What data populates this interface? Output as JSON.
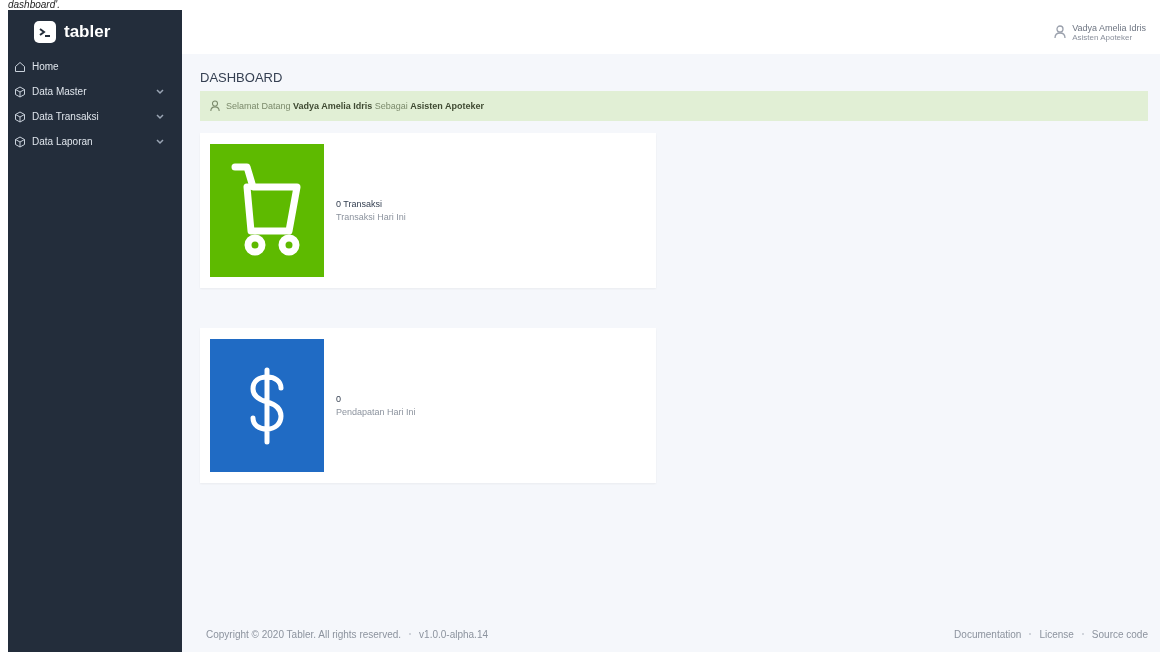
{
  "caption": "dashboard'.",
  "brand": {
    "name": "tabler"
  },
  "sidebar": {
    "items": [
      {
        "label": "Home",
        "kind": "home",
        "expandable": false
      },
      {
        "label": "Data Master",
        "kind": "box",
        "expandable": true
      },
      {
        "label": "Data Transaksi",
        "kind": "box",
        "expandable": true
      },
      {
        "label": "Data Laporan",
        "kind": "box",
        "expandable": true
      }
    ]
  },
  "user": {
    "name": "Vadya Amelia Idris",
    "role": "Asisten Apoteker"
  },
  "page_title": "DASHBOARD",
  "alert": {
    "text": "Selamat Datang **Vadya Amelia Idris** Sebagai **Asisten Apoteker**"
  },
  "cards": [
    {
      "kind": "cart",
      "color": "#5eba00",
      "value": "0 Transaksi",
      "label": "Transaksi Hari Ini"
    },
    {
      "kind": "dollar",
      "color": "#206bc4",
      "value": "0",
      "label": "Pendapatan Hari Ini"
    }
  ],
  "footer": {
    "left": [
      "Copyright © 2020 Tabler. All rights reserved.",
      "v1.0.0-alpha.14"
    ],
    "links": [
      "Documentation",
      "License",
      "Source code"
    ]
  }
}
